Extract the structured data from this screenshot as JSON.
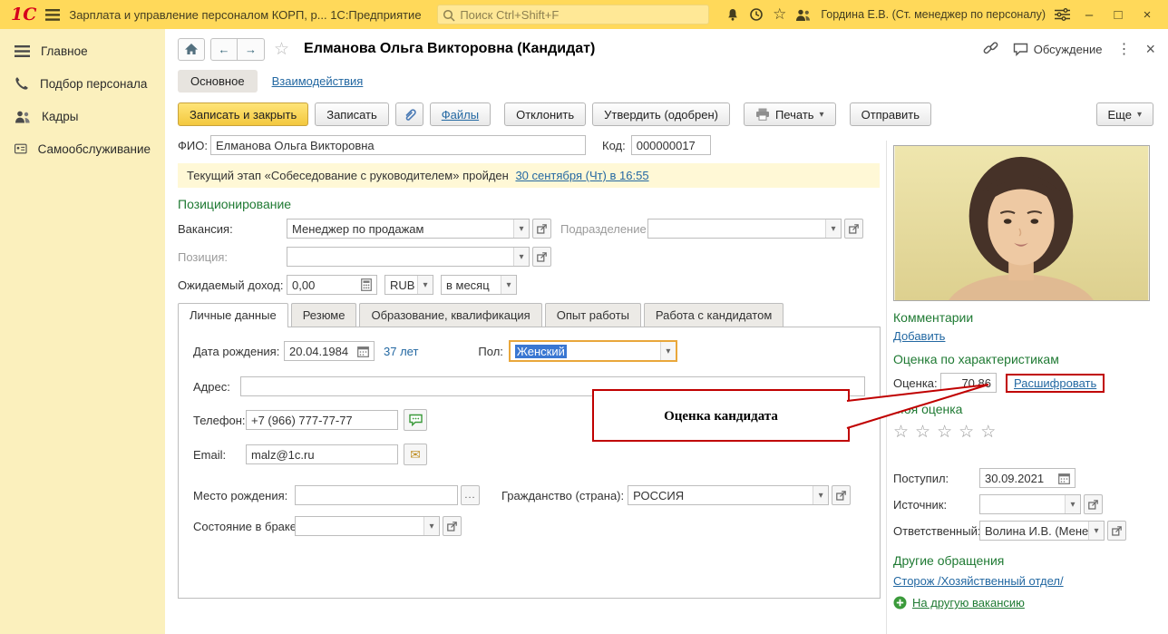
{
  "colors": {
    "topbar": "#ffd95a",
    "sidebar": "#fbf0bd",
    "accent_green": "#1f7a33",
    "link_blue": "#2368a2",
    "callout_red": "#c00000",
    "primary_button": "#f3c83e",
    "selection_blue": "#3a77d2",
    "banner_bg": "#fff8d6"
  },
  "icons": {
    "logo": "1С",
    "back": "←",
    "forward": "→",
    "favorite": "☆",
    "menu_dots": "⋮",
    "close": "×",
    "minimize": "–",
    "maximize": "□",
    "dropdown": "▾",
    "star": "☆",
    "envelope": "✉",
    "ellipsis": "...",
    "plus": "+"
  },
  "topbar": {
    "app_title": "Зарплата и управление персоналом КОРП, р...   1С:Предприятие",
    "search_placeholder": "Поиск Ctrl+Shift+F",
    "user_name": "Гордина Е.В. (Ст. менеджер по персоналу)"
  },
  "sidebar": {
    "items": [
      {
        "label": "Главное"
      },
      {
        "label": "Подбор персонала"
      },
      {
        "label": "Кадры"
      },
      {
        "label": "Самообслуживание"
      }
    ]
  },
  "header": {
    "title": "Елманова Ольга Викторовна (Кандидат)",
    "discussion": "Обсуждение"
  },
  "nav_tabs": {
    "main": "Основное",
    "interactions": "Взаимодействия"
  },
  "toolbar": {
    "save_close": "Записать и закрыть",
    "save": "Записать",
    "files": "Файлы",
    "reject": "Отклонить",
    "approve": "Утвердить (одобрен)",
    "print": "Печать",
    "send": "Отправить",
    "more": "Еще"
  },
  "form": {
    "fio_label": "ФИО:",
    "fio_value": "Елманова Ольга Викторовна",
    "code_label": "Код:",
    "code_value": "000000017",
    "stage_text": "Текущий этап «Собеседование с руководителем» пройден",
    "stage_link": "30 сентября (Чт) в 16:55",
    "positioning_header": "Позиционирование",
    "vacancy_label": "Вакансия:",
    "vacancy_value": "Менеджер по продажам",
    "department_label": "Подразделение:",
    "position_label": "Позиция:",
    "income_label": "Ожидаемый доход:",
    "income_value": "0,00",
    "currency_value": "RUB",
    "period_value": "в месяц",
    "inner_tabs": [
      "Личные данные",
      "Резюме",
      "Образование, квалификация",
      "Опыт работы",
      "Работа с кандидатом"
    ],
    "birthdate_label": "Дата рождения:",
    "birthdate_value": "20.04.1984",
    "age_text": "37 лет",
    "gender_label": "Пол:",
    "gender_value": "Женский",
    "address_label": "Адрес:",
    "phone_label": "Телефон:",
    "phone_value": "+7 (966) 777-77-77",
    "email_label": "Email:",
    "email_value": "malz@1c.ru",
    "birthplace_label": "Место рождения:",
    "citizenship_label": "Гражданство (страна):",
    "citizenship_value": "РОССИЯ",
    "marital_label": "Состояние в браке:"
  },
  "callout": {
    "text": "Оценка кандидата"
  },
  "panel": {
    "comments_header": "Комментарии",
    "add_link": "Добавить",
    "rating_header": "Оценка по характеристикам",
    "score_label": "Оценка:",
    "score_value": "70,86",
    "decrypt_link": "Расшифровать",
    "my_rating_header": "Моя оценка",
    "received_label": "Поступил:",
    "received_value": "30.09.2021",
    "source_label": "Источник:",
    "responsible_label": "Ответственный:",
    "responsible_value": "Волина И.В. (Менедже",
    "other_header": "Другие обращения",
    "other_link": "Сторож /Хозяйственный отдел/",
    "add_vacancy_link": "На другую вакансию"
  }
}
